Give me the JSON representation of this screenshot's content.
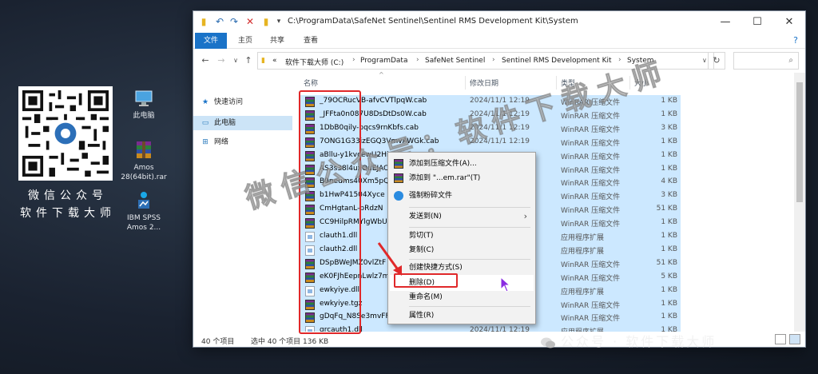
{
  "desktop": {
    "qr_caption_line1": "微信公众号",
    "qr_caption_line2": "软件下载大师",
    "icons": [
      {
        "label": "此电脑",
        "icon": "computer-icon"
      },
      {
        "label": "Amos 28(64bit).rar",
        "icon": "winrar-icon"
      },
      {
        "label": "IBM SPSS Amos 2...",
        "icon": "spss-amos-icon"
      }
    ]
  },
  "window": {
    "path_title": "C:\\ProgramData\\SafeNet Sentinel\\Sentinel RMS Development Kit\\System",
    "ribbon_tabs": [
      "文件",
      "主页",
      "共享",
      "查看"
    ],
    "breadcrumb": [
      "«",
      "软件下载大师 (C:)",
      "ProgramData",
      "SafeNet Sentinel",
      "Sentinel RMS Development Kit",
      "System"
    ],
    "nav": [
      {
        "label": "快速访问",
        "icon": "star-icon"
      },
      {
        "label": "此电脑",
        "icon": "computer-icon",
        "selected": true
      },
      {
        "label": "网络",
        "icon": "network-icon"
      }
    ],
    "columns": [
      "名称",
      "修改日期",
      "类型",
      "大小"
    ],
    "files": [
      {
        "name": "_79OCRucVB-afvCVTlpqW.cab",
        "date": "2024/11/1 12:19",
        "type": "WinRAR 压缩文件",
        "size": "1 KB",
        "kind": "rar"
      },
      {
        "name": "_JFFta0n087U8DsDtDs0W.cab",
        "date": "2024/11/1 12:19",
        "type": "WinRAR 压缩文件",
        "size": "1 KB",
        "kind": "rar"
      },
      {
        "name": "1DbB0qily-pqcs9rnKbfs.cab",
        "date": "2024/11/1 12:19",
        "type": "WinRAR 压缩文件",
        "size": "3 KB",
        "kind": "rar"
      },
      {
        "name": "7ONG1G33izEGQ3VmvAWGk.cab",
        "date": "2024/11/1 12:19",
        "type": "WinRAR 压缩文件",
        "size": "1 KB",
        "kind": "rar"
      },
      {
        "name": "aBllu-y1kvcewU2Hi",
        "date": "",
        "type": "WinRAR 压缩文件",
        "size": "1 KB",
        "kind": "rar"
      },
      {
        "name": "AS3s38l4uxOuEJAC",
        "date": "",
        "type": "WinRAR 压缩文件",
        "size": "1 KB",
        "kind": "rar"
      },
      {
        "name": "B0neums40Xm5pQ",
        "date": "",
        "type": "WinRAR 压缩文件",
        "size": "4 KB",
        "kind": "rar"
      },
      {
        "name": "b1HwP41504Xyce",
        "date": "",
        "type": "WinRAR 压缩文件",
        "size": "3 KB",
        "kind": "rar"
      },
      {
        "name": "CmHgtanL-bRdzN",
        "date": "",
        "type": "WinRAR 压缩文件",
        "size": "51 KB",
        "kind": "rar"
      },
      {
        "name": "CC9HilpRMYlgWbU",
        "date": "",
        "type": "WinRAR 压缩文件",
        "size": "1 KB",
        "kind": "rar"
      },
      {
        "name": "clauth1.dll",
        "date": "",
        "type": "应用程序扩展",
        "size": "1 KB",
        "kind": "dll"
      },
      {
        "name": "clauth2.dll",
        "date": "",
        "type": "应用程序扩展",
        "size": "1 KB",
        "kind": "dll"
      },
      {
        "name": "DSpBWeJMZ0vlZtF",
        "date": "",
        "type": "WinRAR 压缩文件",
        "size": "51 KB",
        "kind": "rar"
      },
      {
        "name": "eK0FJhEepnLwlz7m",
        "date": "",
        "type": "WinRAR 压缩文件",
        "size": "5 KB",
        "kind": "rar"
      },
      {
        "name": "ewkyiye.dll",
        "date": "",
        "type": "应用程序扩展",
        "size": "1 KB",
        "kind": "dll"
      },
      {
        "name": "ewkyiye.tgz",
        "date": "",
        "type": "WinRAR 压缩文件",
        "size": "1 KB",
        "kind": "rar"
      },
      {
        "name": "gDqFq_N8Se3mvFF",
        "date": "",
        "type": "WinRAR 压缩文件",
        "size": "1 KB",
        "kind": "rar"
      },
      {
        "name": "grcauth1.dll",
        "date": "2024/11/1 12:19",
        "type": "应用程序扩展",
        "size": "1 KB",
        "kind": "dll"
      }
    ],
    "status_count": "40 个项目",
    "status_selected": "选中 40 个项目  136 KB"
  },
  "context_menu": {
    "items": [
      {
        "label": "添加到压缩文件(A)...",
        "icon": "winrar-icon"
      },
      {
        "label": "添加到 \"...em.rar\"(T)",
        "icon": "winrar-icon"
      },
      {
        "label": "强制粉碎文件",
        "icon": "shield-icon"
      },
      {
        "label": "发送到(N)",
        "has_submenu": true
      },
      {
        "label": "剪切(T)"
      },
      {
        "label": "复制(C)"
      },
      {
        "label": "创建快捷方式(S)"
      },
      {
        "label": "删除(D)",
        "highlighted": true
      },
      {
        "label": "重命名(M)"
      },
      {
        "label": "属性(R)"
      }
    ]
  },
  "watermarks": {
    "diagonal": "微信公众号：软件下载大师",
    "footer": "公众号 · 软件下载大师"
  },
  "colors": {
    "accent": "#1a73c8",
    "selection": "#cce8ff",
    "annotation_red": "#e0282a"
  }
}
